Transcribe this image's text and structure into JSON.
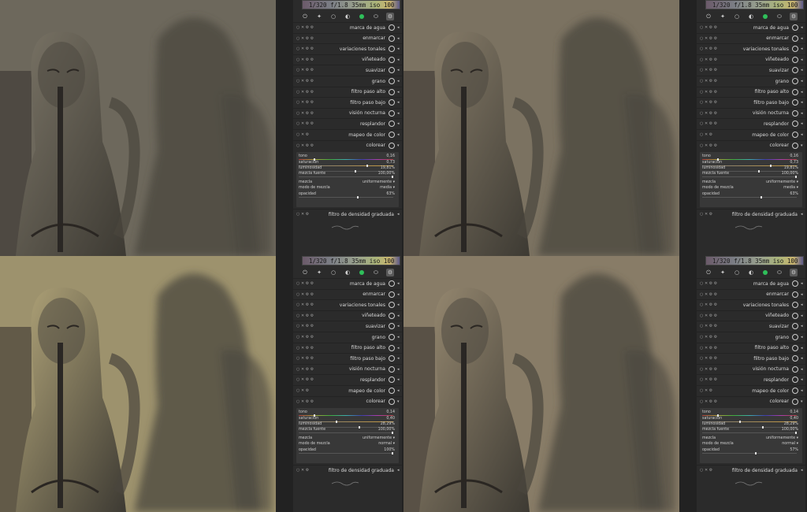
{
  "histogram_text": "1/320 f/1.8 35mm iso 100",
  "tabs": [
    "power-icon",
    "star-icon",
    "circle-icon",
    "half-circle-icon",
    "green-dot-icon",
    "shape-icon",
    "gear-icon"
  ],
  "modules": [
    "marca de agua",
    "enmarcar",
    "variaciones tonales",
    "viñeteado",
    "suavizar",
    "grano",
    "filtro paso alto",
    "filtro paso bajo",
    "visión nocturna",
    "resplandor",
    "mapeo de color",
    "colorear"
  ],
  "bottom_module": "filtro de densidad graduada",
  "panels": [
    {
      "photo": "A",
      "tono": "0,16",
      "saturacion": "0,73",
      "luminosidad": "19,81%",
      "mezcla_fuente": "100,00%",
      "mezcla": "uniformemente",
      "modo": "media",
      "opacidad": "63%",
      "sat_frac": 0.73,
      "lum_frac": 0.6,
      "op_frac": 0.63
    },
    {
      "photo": "B",
      "tono": "0,16",
      "saturacion": "0,73",
      "luminosidad": "19,81%",
      "mezcla_fuente": "100,00%",
      "mezcla": "uniformemente",
      "modo": "media",
      "opacidad": "63%",
      "sat_frac": 0.73,
      "lum_frac": 0.6,
      "op_frac": 0.63
    },
    {
      "photo": "C",
      "tono": "0,14",
      "saturacion": "0,40",
      "luminosidad": "28,29%",
      "mezcla_fuente": "100,00%",
      "mezcla": "uniformemente",
      "modo": "normal",
      "opacidad": "100%",
      "sat_frac": 0.4,
      "lum_frac": 0.64,
      "op_frac": 1.0
    },
    {
      "photo": "D",
      "tono": "0,14",
      "saturacion": "0,40",
      "luminosidad": "28,29%",
      "mezcla_fuente": "100,00%",
      "mezcla": "uniformemente",
      "modo": "normal",
      "opacidad": "57%",
      "sat_frac": 0.4,
      "lum_frac": 0.64,
      "op_frac": 0.57
    }
  ],
  "labels": {
    "tono": "tono",
    "saturacion": "saturación",
    "luminosidad": "luminosidad",
    "mezcla_fuente": "mezcla fuente",
    "mezcla": "mezcla",
    "modo": "modo de mezcla",
    "opacidad": "opacidad"
  },
  "colors": {
    "photoA": "#7a7466",
    "photoB": "#8b806c",
    "photoC": "#b3a67a",
    "photoD": "#9a8c73",
    "panel": "#2b2b2b"
  }
}
